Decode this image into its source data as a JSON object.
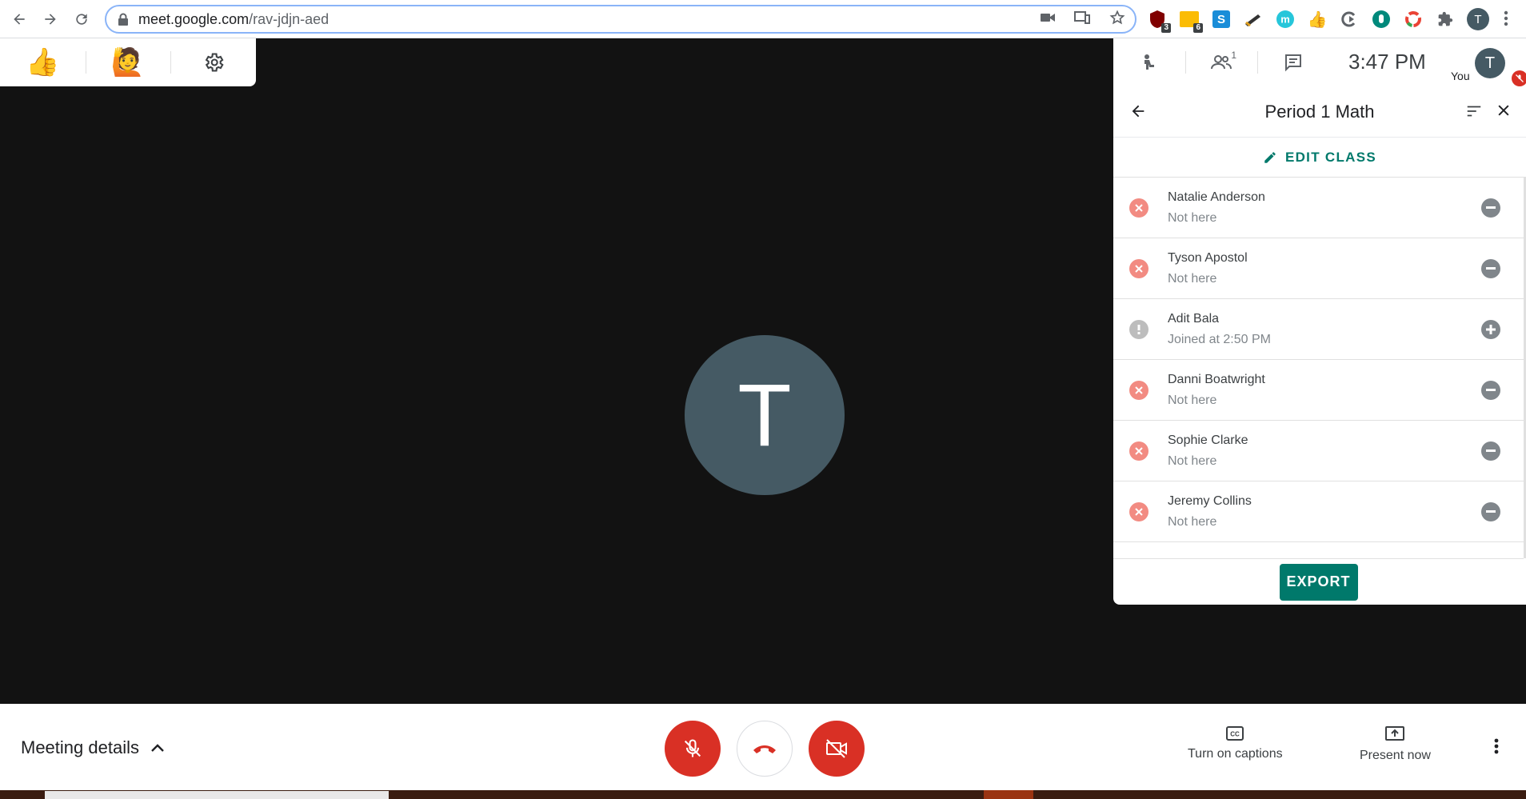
{
  "browser": {
    "url_domain": "meet.google.com",
    "url_path": "/rav-jdjn-aed",
    "extensions": [
      {
        "name": "ublock",
        "badge": "3"
      },
      {
        "name": "google-keep",
        "badge": "6"
      },
      {
        "name": "s-ext",
        "badge": ""
      },
      {
        "name": "pen-ext",
        "badge": ""
      },
      {
        "name": "m-ext",
        "badge": ""
      },
      {
        "name": "thumbs-ext",
        "badge": ""
      },
      {
        "name": "loop-ext",
        "badge": ""
      },
      {
        "name": "hand-ext",
        "badge": ""
      },
      {
        "name": "ring-ext",
        "badge": ""
      },
      {
        "name": "puzzle",
        "badge": ""
      }
    ],
    "profile_initial": "T"
  },
  "reactions": {
    "thumbs_up": "👍",
    "raise_hand": "🙋"
  },
  "stage": {
    "avatar_initial": "T"
  },
  "side_panel": {
    "participant_count": "1",
    "clock": "3:47  PM",
    "you_label": "You",
    "you_initial": "T",
    "class_title": "Period 1 Math",
    "edit_class_label": "EDIT CLASS",
    "students": [
      {
        "name": "Natalie Anderson",
        "status": "Not here",
        "state": "absent"
      },
      {
        "name": "Tyson Apostol",
        "status": "Not here",
        "state": "absent"
      },
      {
        "name": "Adit Bala",
        "status": "Joined at 2:50 PM",
        "state": "late"
      },
      {
        "name": "Danni Boatwright",
        "status": "Not here",
        "state": "absent"
      },
      {
        "name": "Sophie Clarke",
        "status": "Not here",
        "state": "absent"
      },
      {
        "name": "Jeremy Collins",
        "status": "Not here",
        "state": "absent"
      }
    ],
    "export_label": "EXPORT"
  },
  "bottom_bar": {
    "meeting_details": "Meeting details",
    "captions_label": "Turn on captions",
    "present_label": "Present now"
  },
  "colors": {
    "accent_teal": "#00796b",
    "danger_red": "#d93025",
    "absent_red": "#f28b82",
    "avatar_slate": "#455a64"
  }
}
